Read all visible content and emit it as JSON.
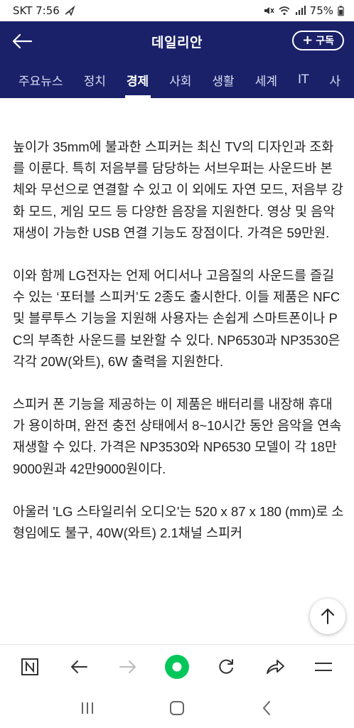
{
  "status_bar": {
    "carrier_time": "SKT 7:56",
    "battery": "75%"
  },
  "header": {
    "title": "데일리안",
    "subscribe_label": "구독",
    "colors": {
      "background": "#1a2169",
      "text": "#ffffff"
    }
  },
  "tabs": [
    {
      "label": "주요뉴스",
      "active": false
    },
    {
      "label": "정치",
      "active": false
    },
    {
      "label": "경제",
      "active": true
    },
    {
      "label": "사회",
      "active": false
    },
    {
      "label": "생활",
      "active": false
    },
    {
      "label": "세계",
      "active": false
    },
    {
      "label": "IT",
      "active": false
    },
    {
      "label": "사",
      "active": false
    }
  ],
  "article": {
    "paragraphs": [
      "높이가 35mm에 불과한 스피커는 최신 TV의 디자인과 조화를 이룬다. 특히 저음부를 담당하는 서브우퍼는 사운드바 본체와 무선으로 연결할 수 있고 이 외에도 자연 모드, 저음부 강화 모드, 게임 모드 등 다양한 음장을 지원한다. 영상 및 음악재생이 가능한 USB 연결 기능도 장점이다. 가격은 59만원.",
      "이와 함께 LG전자는 언제 어디서나 고음질의 사운드를 즐길 수 있는 ‘포터블 스피커’도 2종도 출시한다. 이들 제품은 NFC 및 블루투스 기능을 지원해 사용자는 손쉽게 스마트폰이나 PC의 부족한 사운드를 보완할 수 있다. NP6530과 NP3530은 각각 20W(와트), 6W 출력을 지원한다.",
      "스피커 폰 기능을 제공하는 이 제품은 배터리를 내장해 휴대가 용이하며, 완전 충전 상태에서 8~10시간 동안 음악을 연속 재생할 수 있다. 가격은 NP3530와 NP6530 모델이 각 18만9000원과 42만9000원이다.",
      "아울러 'LG 스타일리쉬 오디오'는 520 x 87 x 180 (mm)로 소형임에도 불구, 40W(와트) 2.1채널 스피커"
    ]
  },
  "browser_toolbar": {
    "items": [
      "naver-home-icon",
      "back-arrow-icon",
      "forward-arrow-icon",
      "green-dot-icon",
      "refresh-icon",
      "share-icon",
      "menu-icon"
    ],
    "accent": "#03c75a"
  },
  "system_nav": {
    "items": [
      "recent-apps-icon",
      "home-icon",
      "back-icon"
    ]
  }
}
